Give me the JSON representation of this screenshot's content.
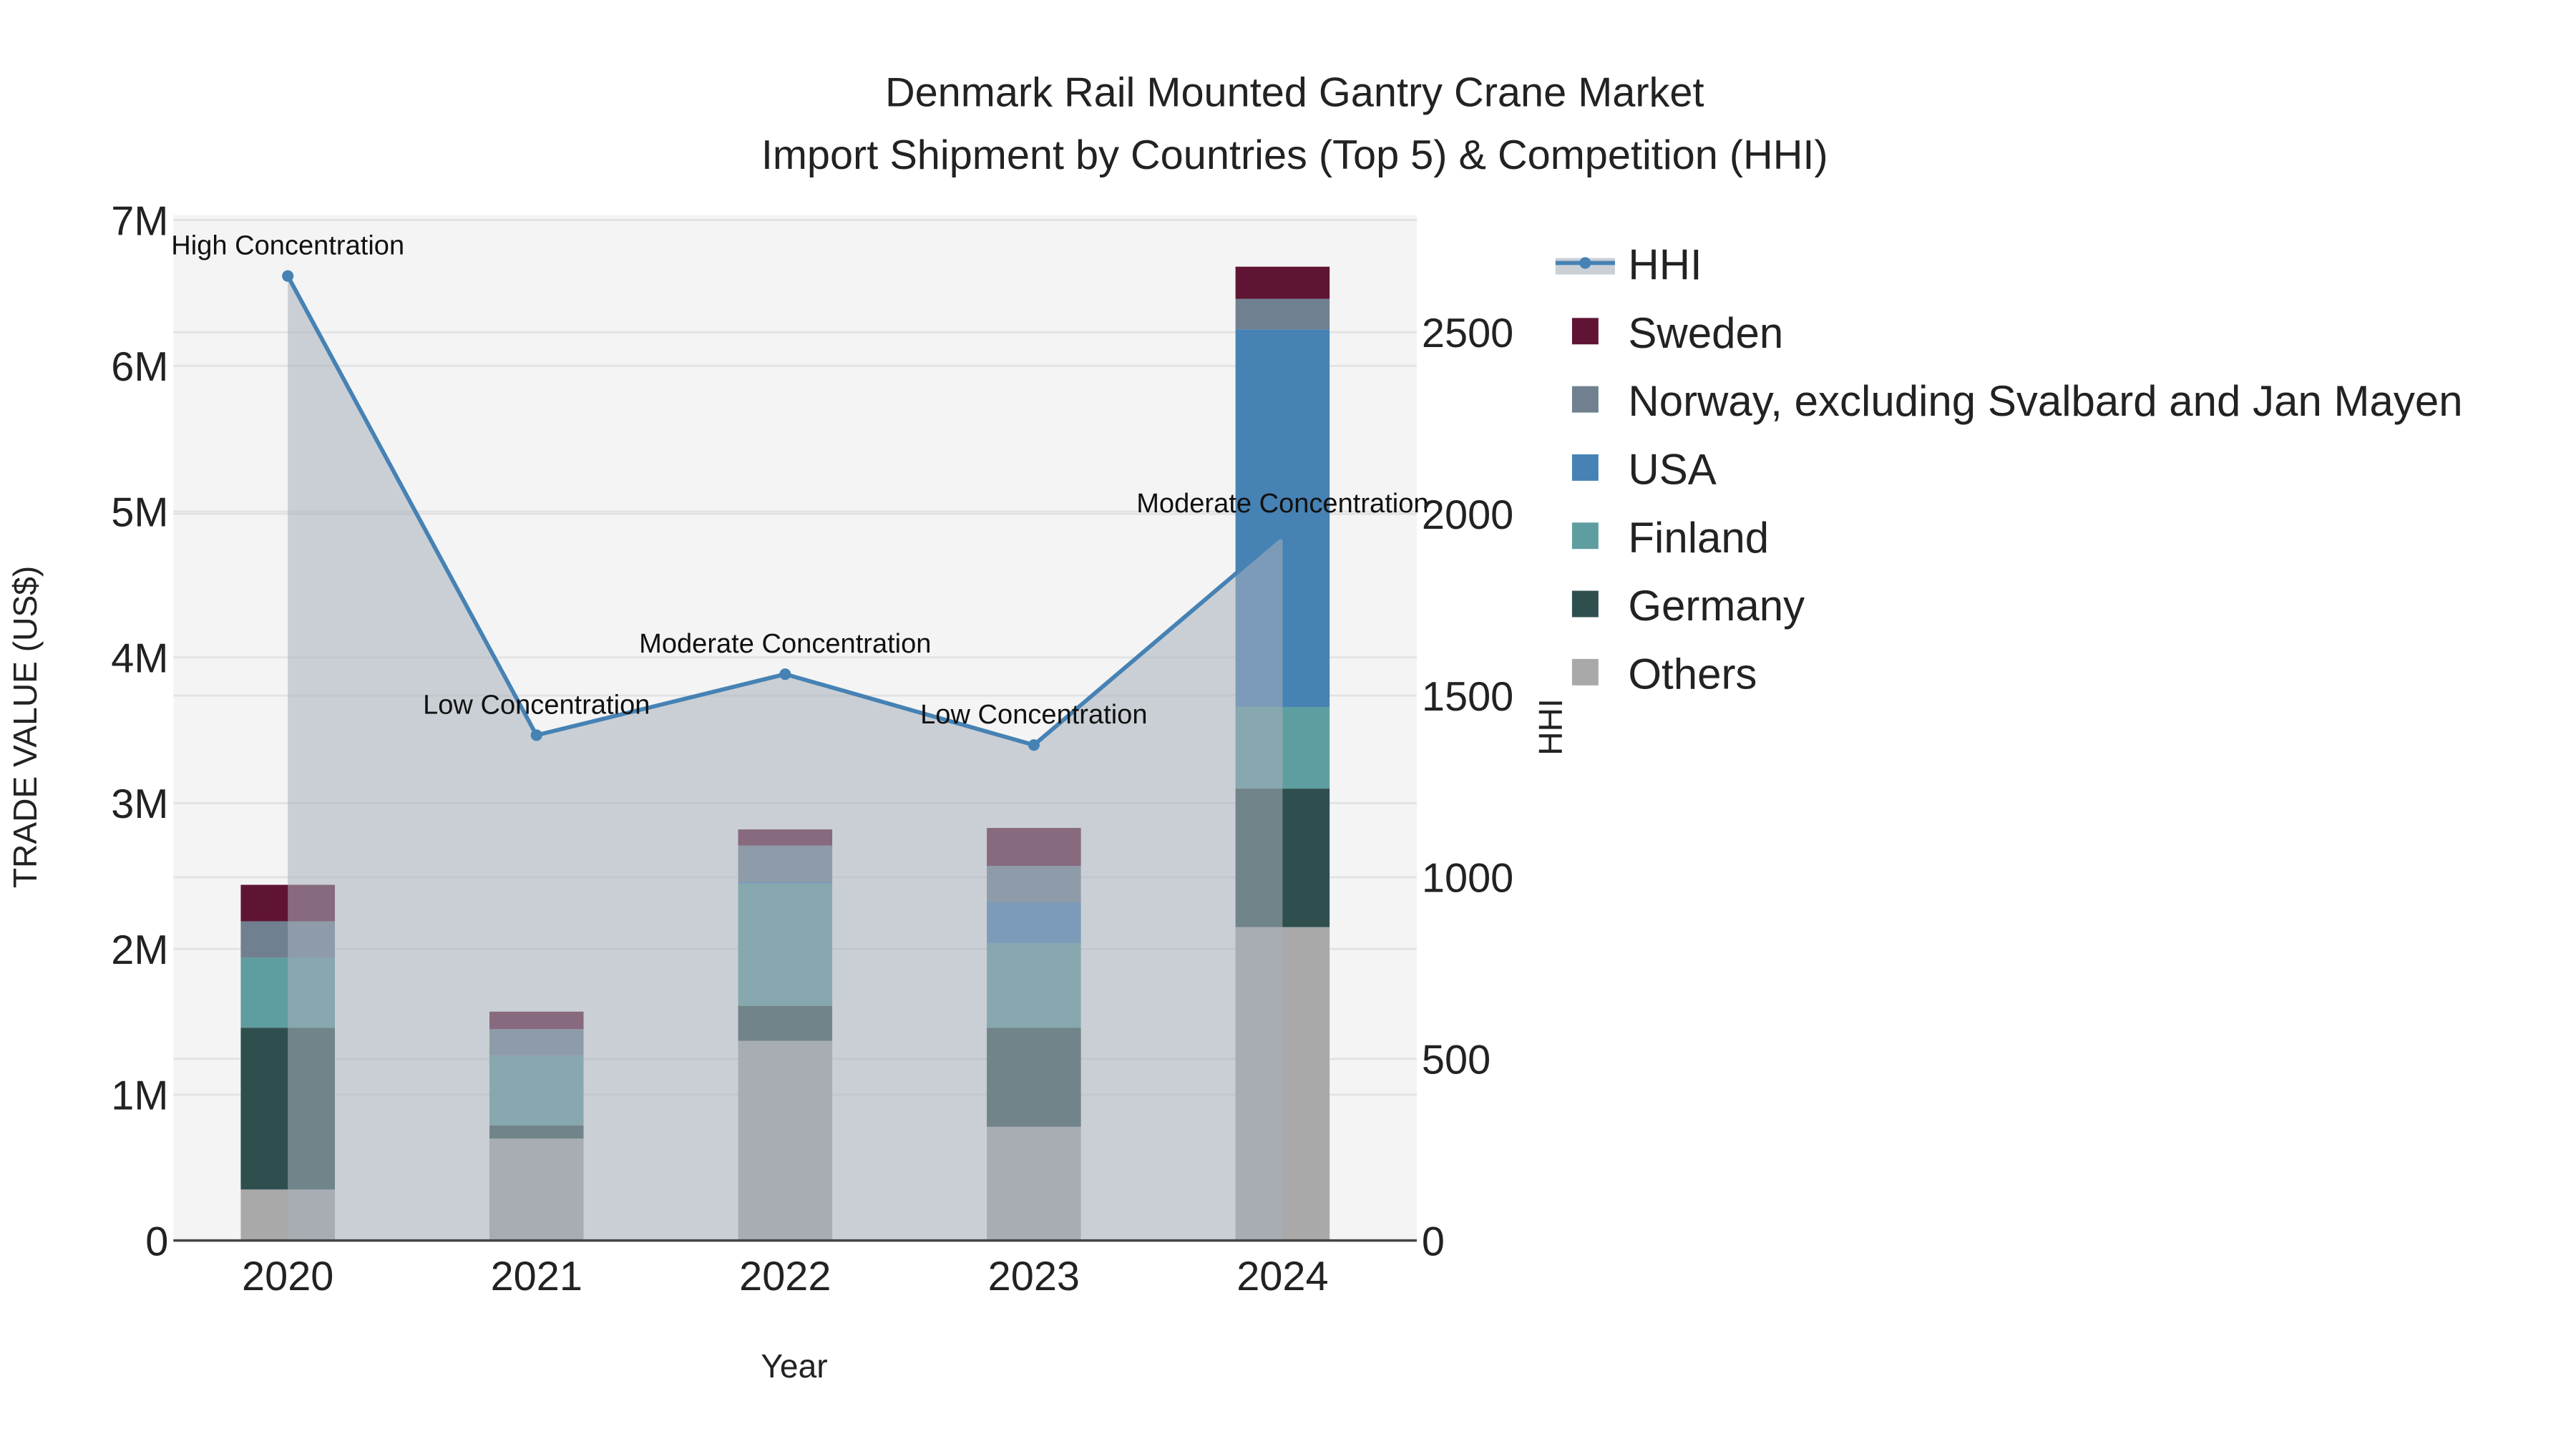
{
  "chart_data": {
    "type": "bar",
    "title_line1": "Denmark Rail Mounted Gantry Crane Market",
    "title_line2": "Import Shipment by Countries (Top 5) & Competition (HHI)",
    "xlabel": "Year",
    "ylabel": "TRADE VALUE (US$)",
    "y2label": "HHI",
    "categories": [
      "2020",
      "2021",
      "2022",
      "2023",
      "2024"
    ],
    "ylim": [
      0,
      7000000
    ],
    "y_ticks": [
      {
        "v": 0,
        "label": "0"
      },
      {
        "v": 1000000,
        "label": "1M"
      },
      {
        "v": 2000000,
        "label": "2M"
      },
      {
        "v": 3000000,
        "label": "3M"
      },
      {
        "v": 4000000,
        "label": "4M"
      },
      {
        "v": 5000000,
        "label": "5M"
      },
      {
        "v": 6000000,
        "label": "6M"
      },
      {
        "v": 7000000,
        "label": "7M"
      }
    ],
    "y2lim": [
      0,
      2813
    ],
    "y2_ticks": [
      {
        "v": 0,
        "label": "0"
      },
      {
        "v": 500,
        "label": "500"
      },
      {
        "v": 1000,
        "label": "1000"
      },
      {
        "v": 1500,
        "label": "1500"
      },
      {
        "v": 2000,
        "label": "2000"
      },
      {
        "v": 2500,
        "label": "2500"
      }
    ],
    "series": [
      {
        "name": "Others",
        "color": "#a9a9a9",
        "values": [
          350000,
          700000,
          1370000,
          780000,
          2150000
        ]
      },
      {
        "name": "Germany",
        "color": "#2f4f4f",
        "values": [
          1110000,
          90000,
          240000,
          680000,
          950000
        ]
      },
      {
        "name": "Finland",
        "color": "#5f9ea0",
        "values": [
          480000,
          480000,
          840000,
          580000,
          560000
        ]
      },
      {
        "name": "USA",
        "color": "#4682b4",
        "values": [
          0,
          0,
          10000,
          280000,
          2590000
        ]
      },
      {
        "name": "Norway, excluding Svalbard and Jan Mayen",
        "color": "#708090",
        "values": [
          250000,
          180000,
          250000,
          250000,
          210000
        ]
      },
      {
        "name": "Sweden",
        "color": "#601434",
        "values": [
          250000,
          120000,
          110000,
          260000,
          220000
        ]
      }
    ],
    "hhi": {
      "name": "HHI",
      "color": "#4682b4",
      "values": [
        2655,
        1391,
        1559,
        1364,
        1945
      ],
      "annotations": [
        "High Concentration",
        "Low Concentration",
        "Moderate Concentration",
        "Low Concentration",
        "Moderate Concentration"
      ]
    },
    "legend_order": [
      "HHI",
      "Sweden",
      "Norway, excluding Svalbard and Jan Mayen",
      "USA",
      "Finland",
      "Germany",
      "Others"
    ],
    "legend_placement": "right",
    "grid": true
  }
}
